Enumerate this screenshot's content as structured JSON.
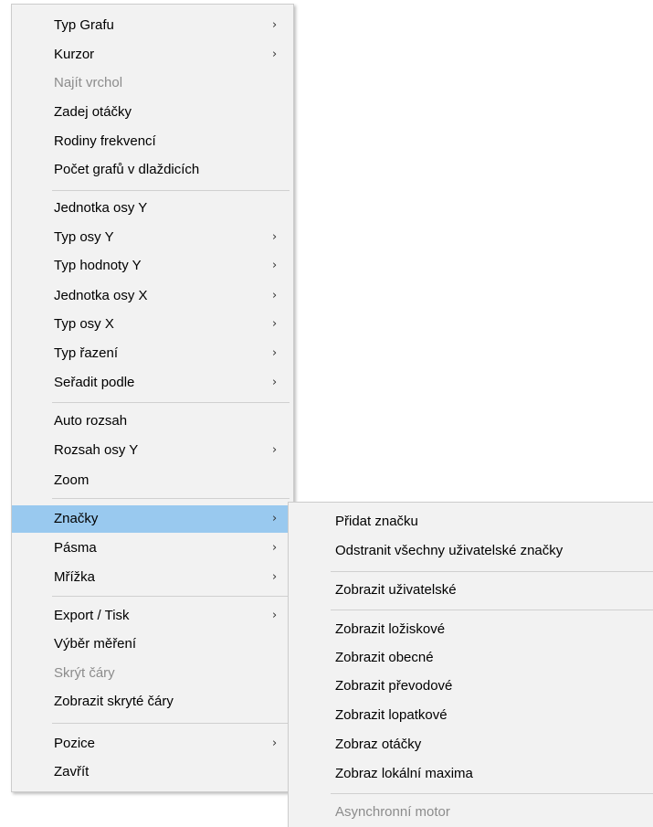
{
  "main_menu": {
    "items": [
      {
        "label": "Typ Grafu",
        "arrow": "›",
        "disabled": false
      },
      {
        "label": "Kurzor",
        "arrow": "›",
        "disabled": false
      },
      {
        "label": "Najít vrchol",
        "arrow": "",
        "disabled": true
      },
      {
        "label": "Zadej otáčky",
        "arrow": "",
        "disabled": false
      },
      {
        "label": "Rodiny frekvencí",
        "arrow": "",
        "disabled": false
      },
      {
        "label": "Počet grafů v dlaždicích",
        "arrow": "",
        "disabled": false
      },
      {
        "label": "Jednotka osy Y",
        "arrow": "",
        "disabled": false
      },
      {
        "label": "Typ osy Y",
        "arrow": "›",
        "disabled": false
      },
      {
        "label": "Typ hodnoty Y",
        "arrow": "›",
        "disabled": false
      },
      {
        "label": "Jednotka osy X",
        "arrow": "›",
        "disabled": false
      },
      {
        "label": "Typ osy X",
        "arrow": "›",
        "disabled": false
      },
      {
        "label": "Typ řazení",
        "arrow": "›",
        "disabled": false
      },
      {
        "label": "Seřadit podle",
        "arrow": "›",
        "disabled": false
      },
      {
        "label": "Auto rozsah",
        "arrow": "",
        "disabled": false
      },
      {
        "label": "Rozsah osy Y",
        "arrow": "›",
        "disabled": false
      },
      {
        "label": "Zoom",
        "arrow": "",
        "disabled": false
      },
      {
        "label": "Značky",
        "arrow": "›",
        "disabled": false,
        "highlighted": true
      },
      {
        "label": "Pásma",
        "arrow": "›",
        "disabled": false
      },
      {
        "label": "Mřížka",
        "arrow": "›",
        "disabled": false
      },
      {
        "label": "Export / Tisk",
        "arrow": "›",
        "disabled": false
      },
      {
        "label": "Výběr měření",
        "arrow": "",
        "disabled": false
      },
      {
        "label": "Skrýt čáry",
        "arrow": "",
        "disabled": true
      },
      {
        "label": "Zobrazit skryté čáry",
        "arrow": "",
        "disabled": false
      },
      {
        "label": "Pozice",
        "arrow": "›",
        "disabled": false
      },
      {
        "label": "Zavřít",
        "arrow": "",
        "disabled": false
      }
    ]
  },
  "sub_menu": {
    "items": [
      {
        "label": "Přidat značku",
        "disabled": false
      },
      {
        "label": "Odstranit všechny uživatelské značky",
        "disabled": false
      },
      {
        "label": "Zobrazit uživatelské",
        "disabled": false
      },
      {
        "label": "Zobrazit ložiskové",
        "disabled": false
      },
      {
        "label": "Zobrazit obecné",
        "disabled": false
      },
      {
        "label": "Zobrazit převodové",
        "disabled": false
      },
      {
        "label": "Zobrazit lopatkové",
        "disabled": false
      },
      {
        "label": "Zobraz otáčky",
        "disabled": false
      },
      {
        "label": "Zobraz lokální maxima",
        "disabled": false
      },
      {
        "label": "Asynchronní motor",
        "disabled": true
      }
    ]
  },
  "colors": {
    "menu_background": "#f2f2f2",
    "highlight": "#99c9ef",
    "disabled_text": "#8c8c8c",
    "separator": "#d0d0d0"
  }
}
